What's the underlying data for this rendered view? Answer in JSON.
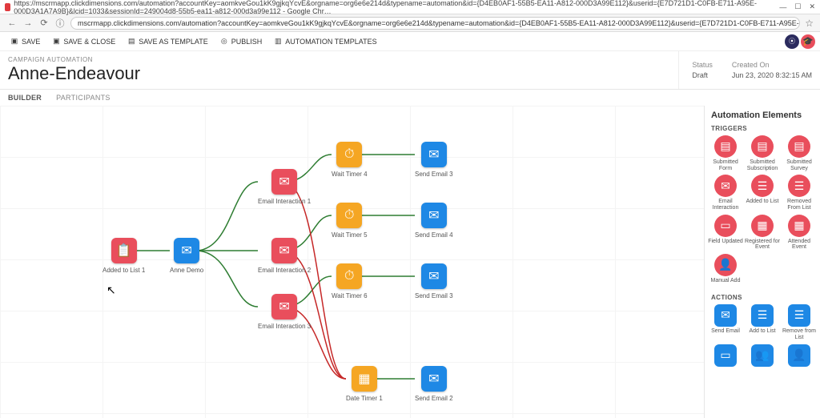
{
  "browser": {
    "tab_title": "https://mscrmapp.clickdimensions.com/automation?accountKey=aomkveGou1kK9gjkqYcvE&orgname=org6e6e214d&typename=automation&id={D4EB0AF1-55B5-EA11-A812-000D3A99E112}&userid={E7D721D1-C0FB-E711-A95E-000D3A1A7A9B}&lcid=1033&sessionId=249004d8-55b5-ea11-a812-000d3a99e112 - Google Chr…",
    "url": "mscrmapp.clickdimensions.com/automation?accountKey=aomkveGou1kK9gjkqYcvE&orgname=org6e6e214d&typename=automation&id={D4EB0AF1-55B5-EA11-A812-000D3A99E112}&userid={E7D721D1-C0FB-E711-A95E-000D3A1A7A9B}&lcid=1033&sessionId=249004d8-55b5-ea11-a812-000d3…",
    "win": {
      "min": "—",
      "max": "☐",
      "close": "✕"
    },
    "nav": {
      "back": "←",
      "fwd": "→",
      "reload": "⟳"
    },
    "lock": "ⓘ",
    "star": "☆"
  },
  "toolbar": {
    "save": "SAVE",
    "save_close": "SAVE & CLOSE",
    "save_as_tmpl": "SAVE AS TEMPLATE",
    "publish": "PUBLISH",
    "templates": "AUTOMATION TEMPLATES"
  },
  "header": {
    "crumb": "CAMPAIGN AUTOMATION",
    "title": "Anne-Endeavour",
    "status_lbl": "Status",
    "status_val": "Draft",
    "created_lbl": "Created On",
    "created_val": "Jun 23, 2020 8:32:15 AM"
  },
  "tabs": {
    "builder": "BUILDER",
    "participants": "PARTICIPANTS"
  },
  "nodes": {
    "added_to_list": "Added to List 1",
    "anne_demo": "Anne Demo",
    "ei1": "Email Interaction 1",
    "ei2": "Email Interaction 2",
    "ei3": "Email Interaction 3",
    "wt4": "Wait Timer 4",
    "wt5": "Wait Timer 5",
    "wt6": "Wait Timer 6",
    "dt1": "Date Timer 1",
    "se3a": "Send Email 3",
    "se4": "Send Email 4",
    "se3b": "Send Email 3",
    "se2": "Send Email 2"
  },
  "panel": {
    "title": "Automation Elements",
    "cat_triggers": "TRIGGERS",
    "cat_actions": "ACTIONS",
    "triggers": {
      "sub_form": "Submitted\nForm",
      "sub_sub": "Submitted\nSubscription",
      "sub_survey": "Submitted\nSurvey",
      "email_int": "Email\nInteraction",
      "added_list": "Added to\nList",
      "removed_list": "Removed\nFrom List",
      "field_upd": "Field\nUpdated",
      "reg_event": "Registered\nfor Event",
      "att_event": "Attended\nEvent",
      "manual_add": "Manual\nAdd"
    },
    "actions": {
      "send_email": "Send Email",
      "add_to_list": "Add to List",
      "remove_list": "Remove\nfrom List",
      "a4": "",
      "a5": "",
      "a6": ""
    }
  }
}
